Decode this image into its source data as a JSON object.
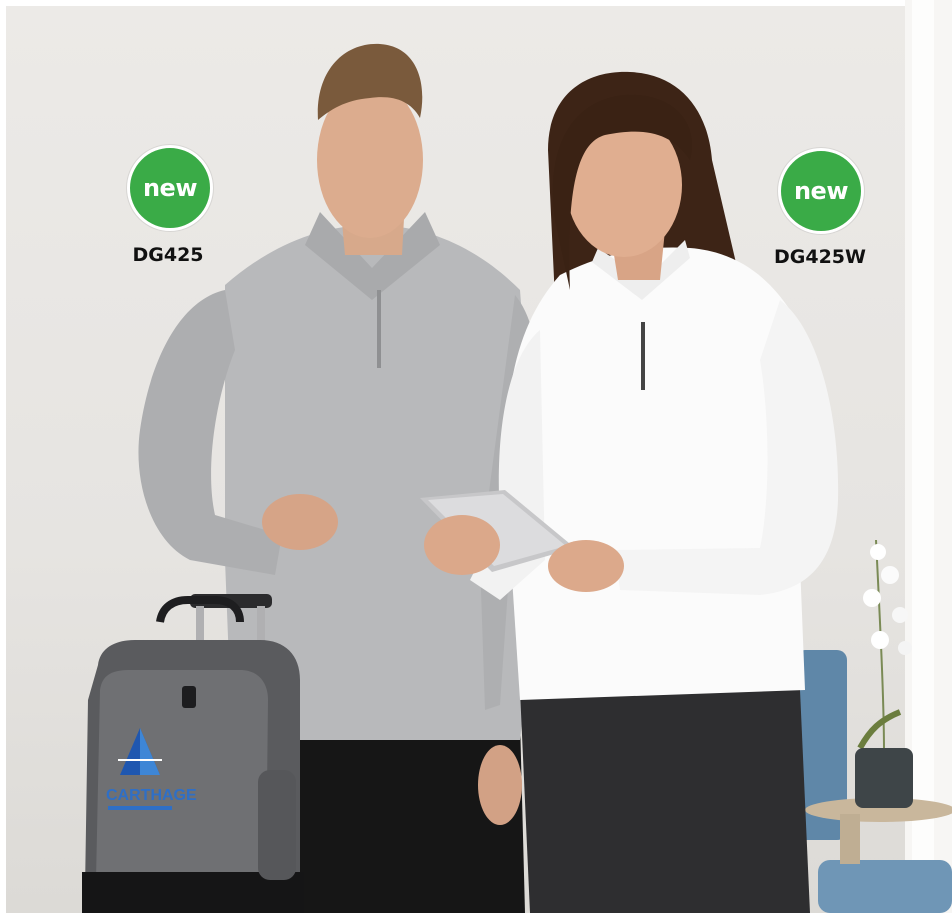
{
  "products": [
    {
      "badge": "new",
      "code": "DG425"
    },
    {
      "badge": "new",
      "code": "DG425W"
    }
  ],
  "bag_logo": {
    "name": "CARTHAGE"
  },
  "colors": {
    "badge_green": "#3aab47",
    "badge_text": "#ffffff",
    "code_text": "#111111",
    "background": "#e8e6e3"
  }
}
